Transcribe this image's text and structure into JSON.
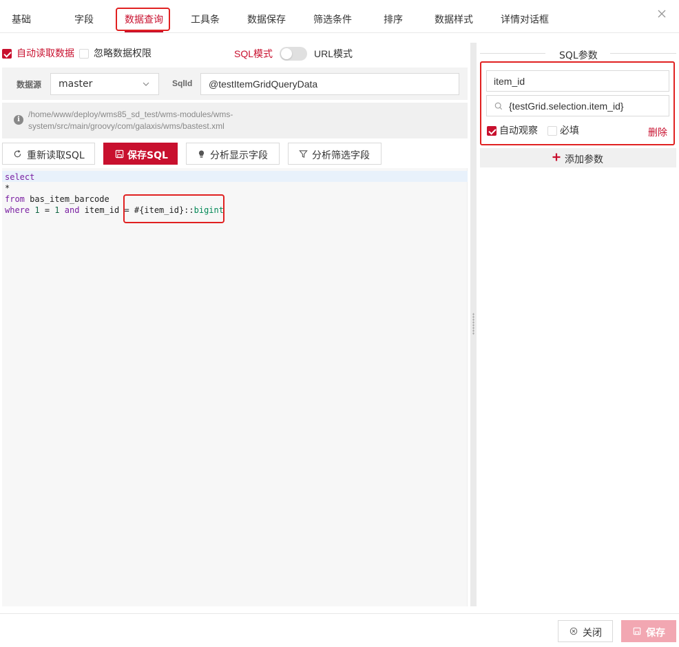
{
  "tabs": [
    {
      "label": "基础"
    },
    {
      "label": "字段"
    },
    {
      "label": "数据查询"
    },
    {
      "label": "工具条"
    },
    {
      "label": "数据保存"
    },
    {
      "label": "筛选条件"
    },
    {
      "label": "排序"
    },
    {
      "label": "数据样式"
    },
    {
      "label": "详情对话框"
    }
  ],
  "active_tab": "数据查询",
  "options": {
    "auto_read_label": "自动读取数据",
    "auto_read_checked": true,
    "ignore_perm_label": "忽略数据权限",
    "ignore_perm_checked": false,
    "sql_mode_label": "SQL模式",
    "url_mode_label": "URL模式"
  },
  "datasource": {
    "label": "数据源",
    "value": "master",
    "sqlid_label": "SqlId",
    "sqlid_value": "@testItemGridQueryData"
  },
  "path": {
    "line1": "/home/www/deploy/wms85_sd_test/wms-modules/wms-",
    "line2": "system/src/main/groovy/com/galaxis/wms/bastest.xml"
  },
  "buttons": {
    "reload_sql": "重新读取SQL",
    "save_sql": "保存SQL",
    "analyze_display": "分析显示字段",
    "analyze_filter": "分析筛选字段"
  },
  "editor": {
    "lines": {
      "l1_kw": "select",
      "l2": "*",
      "l3_kw": "from",
      "l3_rest": " bas_item_barcode",
      "l4_kw1": "where",
      "l4_num1": "1",
      "l4_eq": " = ",
      "l4_num2": "1",
      "l4_kw2": "and",
      "l4_mid": " item_id = ",
      "l4_param": "#{item_id}::",
      "l4_type": "bigint"
    }
  },
  "right_panel": {
    "title": "SQL参数",
    "param_name": "item_id",
    "param_expr": "{testGrid.selection.item_id}",
    "auto_watch_label": "自动观察",
    "auto_watch_checked": true,
    "required_label": "必填",
    "required_checked": false,
    "delete_label": "删除",
    "add_param_label": "添加参数"
  },
  "footer": {
    "close_label": "关闭",
    "save_label": "保存"
  },
  "colors": {
    "accent": "#c8102e",
    "highlight_box": "#e02020"
  }
}
